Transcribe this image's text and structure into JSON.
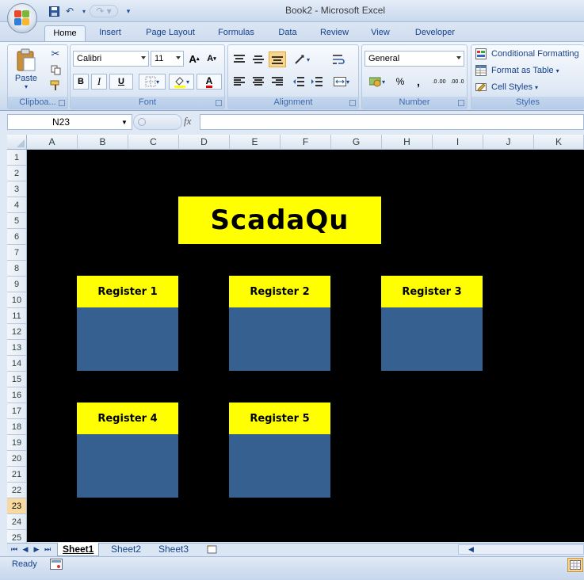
{
  "window": {
    "title": "Book2 - Microsoft Excel"
  },
  "ribbon_tabs": [
    "Home",
    "Insert",
    "Page Layout",
    "Formulas",
    "Data",
    "Review",
    "View",
    "Developer"
  ],
  "clipboard": {
    "paste_label": "Paste",
    "group_label": "Clipboa..."
  },
  "font": {
    "name": "Calibri",
    "size": "11",
    "group_label": "Font",
    "bold": "B",
    "italic": "I",
    "underline": "U",
    "grow": "A",
    "shrink": "A",
    "font_color_letter": "A"
  },
  "alignment": {
    "group_label": "Alignment"
  },
  "number": {
    "format": "General",
    "group_label": "Number",
    "percent": "%",
    "comma": ",",
    "inc_decimal": ".0 .00",
    "dec_decimal": ".00 .0"
  },
  "styles": {
    "conditional_formatting": "Conditional Formatting",
    "format_as_table": "Format as Table",
    "cell_styles": "Cell Styles",
    "group_label": "Styles"
  },
  "formula_bar": {
    "name_box": "N23",
    "fx_label": "fx",
    "formula": ""
  },
  "columns": [
    "A",
    "B",
    "C",
    "D",
    "E",
    "F",
    "G",
    "H",
    "I",
    "J",
    "K"
  ],
  "rows": [
    "1",
    "2",
    "3",
    "4",
    "5",
    "6",
    "7",
    "8",
    "9",
    "10",
    "11",
    "12",
    "13",
    "14",
    "15",
    "16",
    "17",
    "18",
    "19",
    "20",
    "21",
    "22",
    "23",
    "24",
    "25"
  ],
  "active_row": "23",
  "sheet": {
    "logo_text": "ScadaQu",
    "registers": [
      "Register 1",
      "Register 2",
      "Register 3",
      "Register 4",
      "Register 5"
    ]
  },
  "sheet_tabs": [
    "Sheet1",
    "Sheet2",
    "Sheet3"
  ],
  "status": {
    "ready": "Ready"
  },
  "colors": {
    "sheet_bg": "#000000",
    "header_yellow": "#ffff00",
    "register_body": "#36608f"
  }
}
